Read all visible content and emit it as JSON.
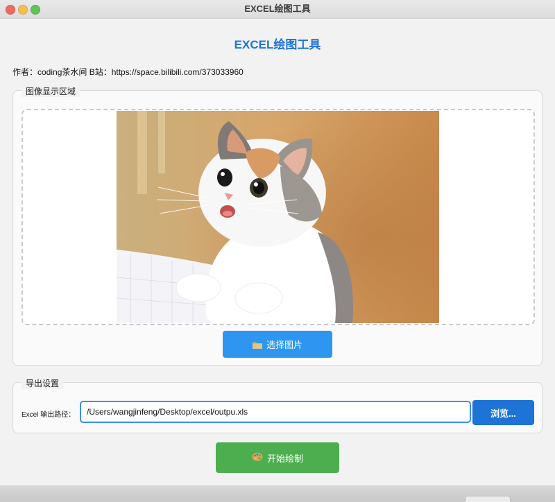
{
  "window": {
    "title": "EXCEL绘图工具"
  },
  "app": {
    "heading": "EXCEL绘图工具"
  },
  "author_line": "作者：coding茶水间 B站：https://space.bilibili.com/373033960",
  "image_section": {
    "title": "图像显示区域",
    "image_alt": "cat photo",
    "select_button": {
      "icon": "folder-icon",
      "label": "选择图片"
    }
  },
  "export_section": {
    "title": "导出设置",
    "path_label": "Excel 输出路径：",
    "path_value": "/Users/wangjinfeng/Desktop/excel/outpu.xls",
    "browse_label": "浏览..."
  },
  "start_button": {
    "icon": "palette-icon",
    "label": "开始绘制"
  },
  "colors": {
    "accent_blue": "#1e74d6",
    "select_button": "#2e96f0",
    "browse_button": "#1d74d6",
    "start_button": "#4cae4f"
  }
}
